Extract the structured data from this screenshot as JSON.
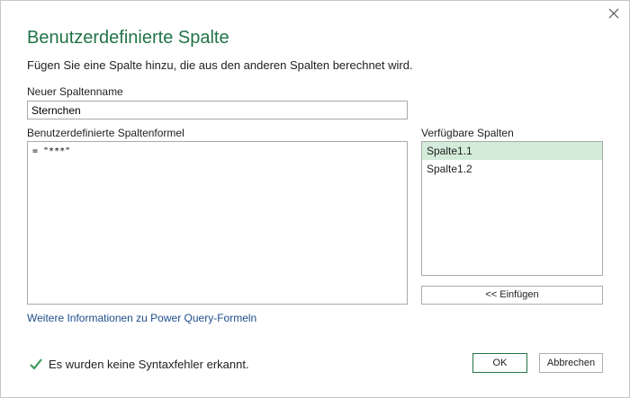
{
  "dialog": {
    "title": "Benutzerdefinierte Spalte",
    "subtitle": "Fügen Sie eine Spalte hinzu, die aus den anderen Spalten berechnet wird.",
    "accent_color": "#217346"
  },
  "name_field": {
    "label": "Neuer Spaltenname",
    "value": "Sternchen"
  },
  "formula_field": {
    "label": "Benutzerdefinierte Spaltenformel",
    "value": "= \"***\""
  },
  "available_columns": {
    "label": "Verfügbare Spalten",
    "items": [
      {
        "label": "Spalte1.1",
        "selected": true
      },
      {
        "label": "Spalte1.2",
        "selected": false
      }
    ],
    "insert_label": "<< Einfügen"
  },
  "help_link": "Weitere Informationen zu Power Query-Formeln",
  "status": {
    "icon": "check-icon",
    "text": "Es wurden keine Syntaxfehler erkannt."
  },
  "buttons": {
    "ok": "OK",
    "cancel": "Abbrechen"
  }
}
